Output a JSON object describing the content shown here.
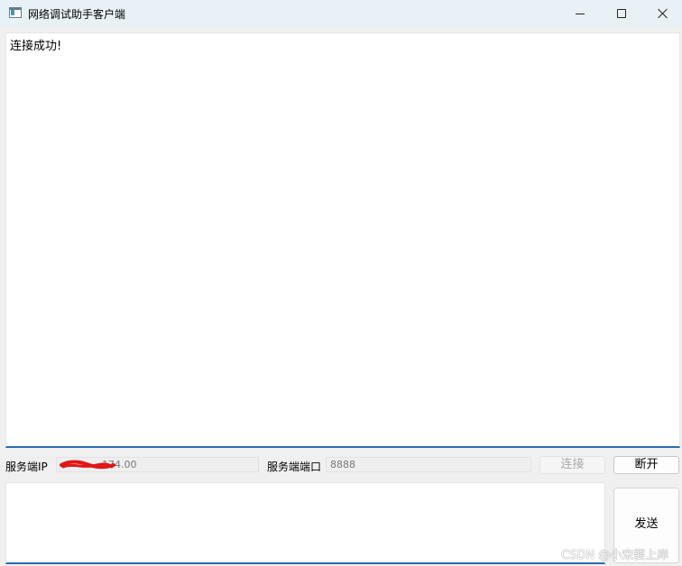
{
  "window": {
    "title": "网络调试助手客户端",
    "controls": [
      "minimize-icon",
      "maximize-icon",
      "close-icon"
    ]
  },
  "receive_area": {
    "text": "连接成功!"
  },
  "server_ip": {
    "label": "服务端IP",
    "value_suffix": "174.00",
    "redacted": true
  },
  "server_port": {
    "label": "服务端端口",
    "value": "8888"
  },
  "buttons": {
    "connect": "连接",
    "disconnect": "断开",
    "send": "发送"
  },
  "send_area": {
    "text": ""
  },
  "watermark": "CSDN @小宋要上岸",
  "colors": {
    "titlebar": "#e8f2f6",
    "focus_border": "#2a6db3",
    "disabled_text": "#a8a8a8",
    "redaction": "#e01818"
  }
}
